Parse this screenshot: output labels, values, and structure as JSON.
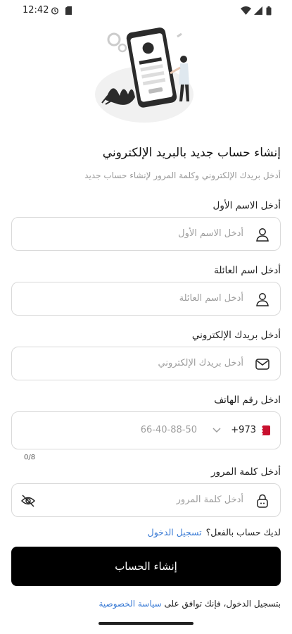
{
  "status_bar": {
    "time": "12:42"
  },
  "header": {
    "title": "إنشاء حساب جديد بالبريد الإلكتروني",
    "subtitle": "أدخل بريدك الإلكتروني وكلمة المرور لإنشاء حساب جديد"
  },
  "form": {
    "first_name": {
      "label": "أدخل الاسم الأول",
      "placeholder": "أدخل الاسم الأول"
    },
    "last_name": {
      "label": "أدخل اسم العائلة",
      "placeholder": "أدخل اسم العائلة"
    },
    "email": {
      "label": "أدخل بريدك الإلكتروني",
      "placeholder": "أدخل بريدك الإلكتروني"
    },
    "phone": {
      "label": "ادخل رقم الهاتف",
      "country_code": "+973",
      "placeholder": "66-40-88-50",
      "counter": "0/8"
    },
    "password": {
      "label": "أدخل كلمة المرور",
      "placeholder": "أدخل كلمة المرور"
    }
  },
  "login": {
    "prompt": "لديك حساب بالفعل؟",
    "link": "تسجيل الدخول"
  },
  "submit": {
    "label": "إنشاء الحساب"
  },
  "terms": {
    "text": "بتسجيل الدخول، فإنك توافق على",
    "link": "سياسة الخصوصية"
  },
  "colors": {
    "accent": "#3a7bd5",
    "button": "#000000",
    "border": "#d9d9d9",
    "flag": "#c8102e"
  }
}
